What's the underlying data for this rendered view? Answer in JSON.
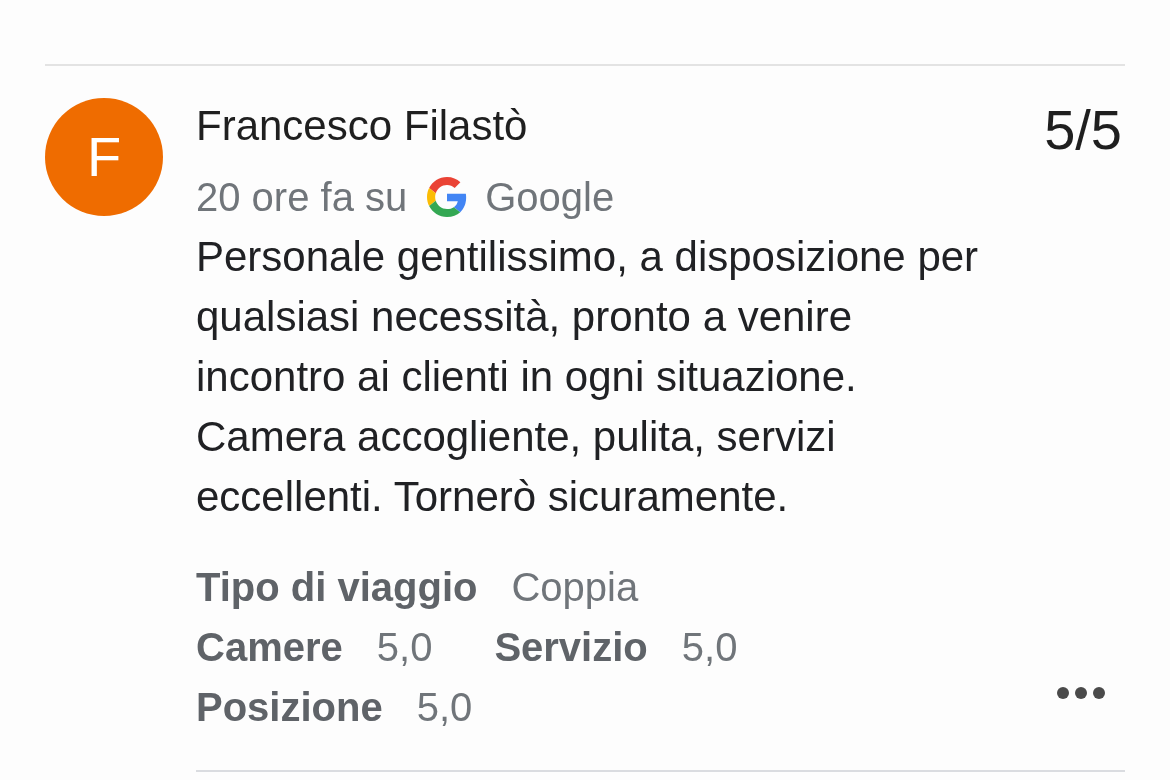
{
  "review": {
    "reviewer": {
      "initial": "F",
      "name": "Francesco Filastò"
    },
    "rating": "5/5",
    "time": "20 ore fa su",
    "source": "Google",
    "text": "Personale gentilissimo, a disposizione per qualsiasi necessità, pronto a venire incontro ai clienti in ogni situazione. Camera accogliente, pulita, servizi eccellenti. Tornerò sicuramente.",
    "detail_rows": [
      {
        "items": [
          {
            "label": "Tipo di viaggio",
            "value": "Coppia"
          }
        ]
      },
      {
        "items": [
          {
            "label": "Camere",
            "value": "5,0"
          },
          {
            "label": "Servizio",
            "value": "5,0"
          }
        ]
      },
      {
        "items": [
          {
            "label": "Posizione",
            "value": "5,0"
          }
        ]
      }
    ]
  }
}
